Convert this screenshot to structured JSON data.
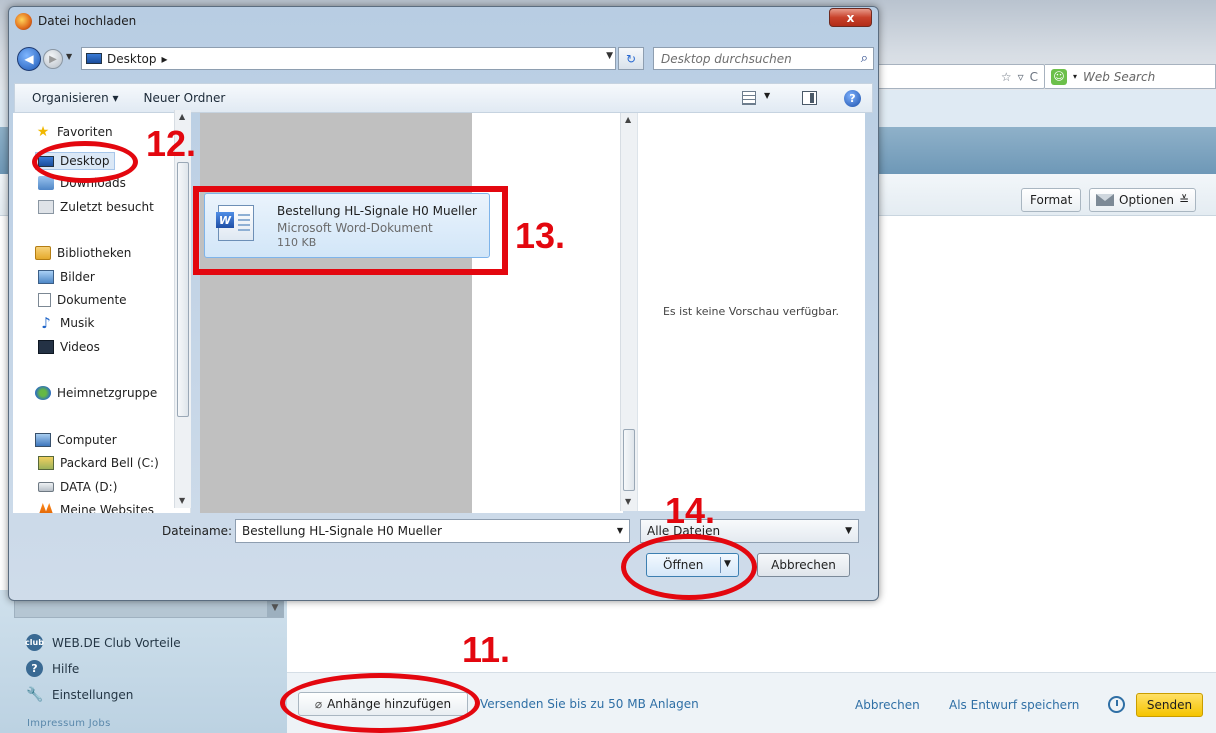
{
  "browser": {
    "search_placeholder": "Web Search"
  },
  "mail": {
    "format_label": "Format",
    "optionen_label": "Optionen",
    "optionen_chevron": "≚",
    "sidebar": {
      "items": [
        {
          "label": "WEB.DE Club Vorteile",
          "icon": "club-icon"
        },
        {
          "label": "Hilfe",
          "icon": "help-icon"
        },
        {
          "label": "Einstellungen",
          "icon": "wrench-icon"
        }
      ],
      "footer": "Impressum  Jobs"
    },
    "bottom": {
      "attach_label": "Anhänge hinzufügen",
      "attach_note": "Versenden Sie bis zu 50 MB Anlagen",
      "cancel_label": "Abbrechen",
      "draft_label": "Als Entwurf speichern",
      "send_label": "Senden"
    }
  },
  "dialog": {
    "title": "Datei hochladen",
    "close_label": "x",
    "address": "Desktop",
    "address_arrow": "▸",
    "search_placeholder": "Desktop durchsuchen",
    "toolbar": {
      "organize": "Organisieren ▾",
      "new_folder": "Neuer Ordner"
    },
    "nav": {
      "favorites": "Favoriten",
      "desktop": "Desktop",
      "downloads": "Downloads",
      "recent": "Zuletzt besucht",
      "libraries": "Bibliotheken",
      "pictures": "Bilder",
      "documents": "Dokumente",
      "music": "Musik",
      "videos": "Videos",
      "homegroup": "Heimnetzgruppe",
      "computer": "Computer",
      "drive_c": "Packard Bell (C:)",
      "drive_d": "DATA (D:)",
      "websites": "Meine Websites"
    },
    "file": {
      "name": "Bestellung HL-Signale H0 Mueller",
      "type": "Microsoft Word-Dokument",
      "size": "110 KB"
    },
    "preview_text": "Es ist keine Vorschau verfügbar.",
    "filename_label": "Dateiname:",
    "filename_value": "Bestellung HL-Signale H0 Mueller",
    "filetype_value": "Alle Dateien",
    "open_label": "Öffnen",
    "cancel_label": "Abbrechen"
  },
  "annotations": {
    "step11": "11.",
    "step12": "12.",
    "step13": "13.",
    "step14": "14.",
    "color": "#e3070f"
  }
}
